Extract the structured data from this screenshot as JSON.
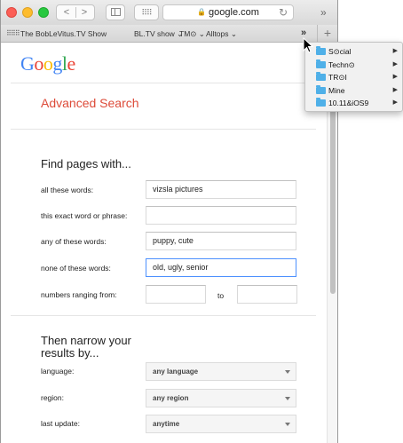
{
  "browser": {
    "url": "google.com",
    "nav_back": "<",
    "nav_forward": ">",
    "grid_glyph": "⠿⠿",
    "lock_glyph": "🔒",
    "reload_glyph": "↻",
    "more_glyph": "»"
  },
  "bookmarks": {
    "apps_glyph": "⠿⠿⠿",
    "items": [
      "The BobLeVitus.TV Show",
      "BL.TV show ⌄",
      "TM⊙ ⌄",
      "Alltops ⌄"
    ],
    "overflow_glyph": "»",
    "add_glyph": "+"
  },
  "bookmark_menu": {
    "items": [
      "S⊙cial",
      "Techn⊙",
      "TR⊙I",
      "Mine",
      "10.11&iOS9"
    ]
  },
  "page": {
    "logo": {
      "G": "G",
      "o1": "o",
      "o2": "o",
      "g": "g",
      "l": "l",
      "e": "e"
    },
    "title": "Advanced Search",
    "find_heading": "Find pages with...",
    "fields": [
      {
        "label": "all these words:",
        "value": "vizsla pictures"
      },
      {
        "label": "this exact word or phrase:",
        "value": ""
      },
      {
        "label": "any of these words:",
        "value": "puppy, cute"
      },
      {
        "label": "none of these words:",
        "value": "old, ugly, senior"
      }
    ],
    "range_label": "numbers ranging from:",
    "range_to": "to",
    "narrow_heading_1": "Then narrow your",
    "narrow_heading_2": "results by...",
    "filters": [
      {
        "label": "language:",
        "value": "any language"
      },
      {
        "label": "region:",
        "value": "any region"
      },
      {
        "label": "last update:",
        "value": "anytime"
      }
    ]
  },
  "colors": {
    "accent_red": "#dd4b39",
    "focus_blue": "#4d90fe",
    "folder_blue": "#4fb0e8"
  }
}
